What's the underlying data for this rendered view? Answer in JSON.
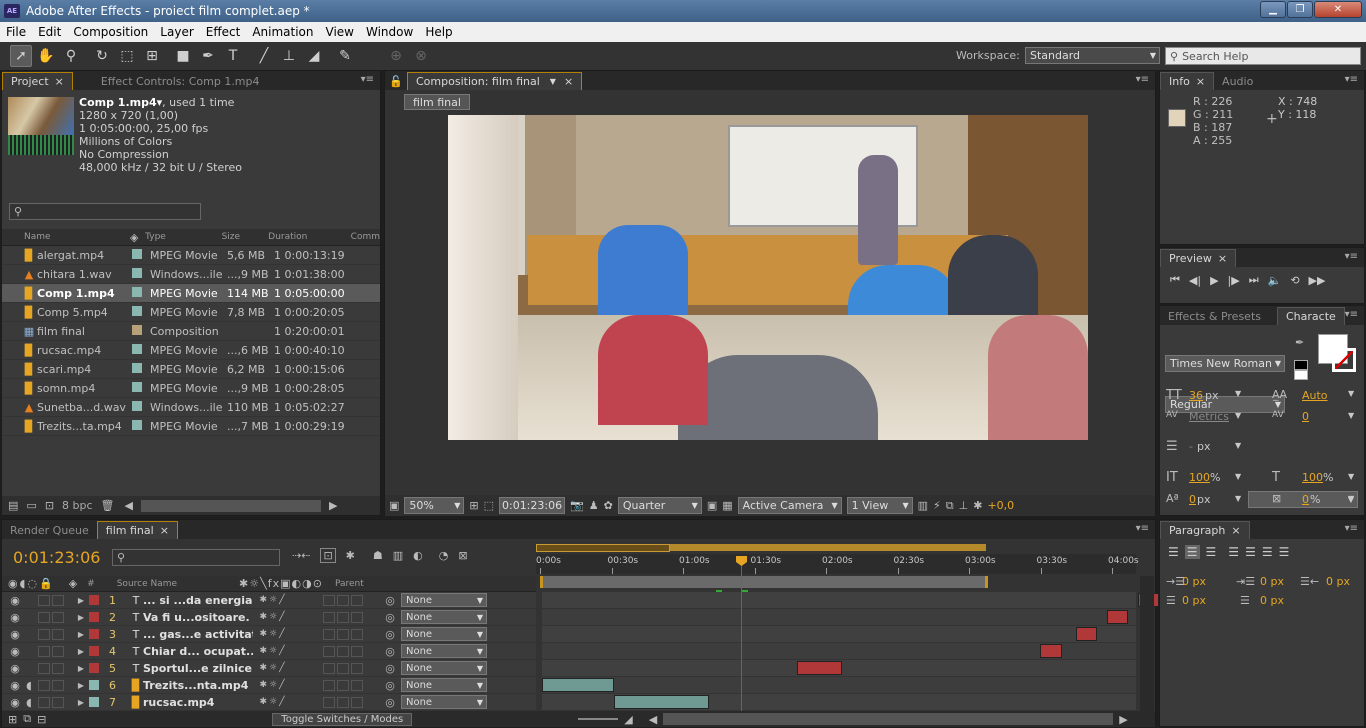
{
  "app": {
    "title": "Adobe After Effects - proiect film complet.aep *",
    "logo": "AE"
  },
  "menu": [
    "File",
    "Edit",
    "Composition",
    "Layer",
    "Effect",
    "Animation",
    "View",
    "Window",
    "Help"
  ],
  "toolbar": {
    "tools": [
      "selection-icon",
      "hand-icon",
      "zoom-icon",
      "rotation-icon",
      "camera-orbit-icon",
      "pan-behind-icon",
      "rectangle-mask-icon",
      "pen-icon",
      "type-icon",
      "brush-icon",
      "clone-stamp-icon",
      "eraser-icon",
      "puppet-pin-icon"
    ],
    "workspace_label": "Workspace:",
    "workspace_value": "Standard",
    "search_placeholder": "Search Help"
  },
  "project": {
    "tab_project": "Project",
    "tab_effect_controls": "Effect Controls: Comp 1.mp4",
    "footage_name": "Comp 1.mp4▾",
    "footage_used": ", used 1 time",
    "details": [
      "1280 x 720 (1,00)",
      "1 0:05:00:00, 25,00 fps",
      "Millions of Colors",
      "No Compression",
      "48,000 kHz / 32 bit U / Stereo"
    ],
    "columns": {
      "name": "Name",
      "type": "Type",
      "size": "Size",
      "duration": "Duration",
      "comment": "Comm"
    },
    "items": [
      {
        "name": "alergat.mp4",
        "type": "MPEG Movie",
        "size": "5,6 MB",
        "duration": "1 0:00:13:19",
        "icon": "movie-file-icon",
        "label": "#8ab8b0"
      },
      {
        "name": "chitara 1.wav",
        "type": "Windows...ile",
        "size": "...,9 MB",
        "duration": "1 0:01:38:00",
        "icon": "audio-file-icon",
        "label": "#8ab8b0"
      },
      {
        "name": "Comp 1.mp4",
        "type": "MPEG Movie",
        "size": "114 MB",
        "duration": "1 0:05:00:00",
        "icon": "movie-file-icon",
        "label": "#8ab8b0",
        "selected": true
      },
      {
        "name": "Comp 5.mp4",
        "type": "MPEG Movie",
        "size": "7,8 MB",
        "duration": "1 0:00:20:05",
        "icon": "movie-file-icon",
        "label": "#8ab8b0"
      },
      {
        "name": "film final",
        "type": "Composition",
        "size": "",
        "duration": "1 0:20:00:01",
        "icon": "composition-icon",
        "label": "#b8a078"
      },
      {
        "name": "rucsac.mp4",
        "type": "MPEG Movie",
        "size": "...,6 MB",
        "duration": "1 0:00:40:10",
        "icon": "movie-file-icon",
        "label": "#8ab8b0"
      },
      {
        "name": "scari.mp4",
        "type": "MPEG Movie",
        "size": "6,2 MB",
        "duration": "1 0:00:15:06",
        "icon": "movie-file-icon",
        "label": "#8ab8b0"
      },
      {
        "name": "somn.mp4",
        "type": "MPEG Movie",
        "size": "...,9 MB",
        "duration": "1 0:00:28:05",
        "icon": "movie-file-icon",
        "label": "#8ab8b0"
      },
      {
        "name": "Sunetba...d.wav",
        "type": "Windows...ile",
        "size": "110 MB",
        "duration": "1 0:05:02:27",
        "icon": "audio-file-icon",
        "label": "#8ab8b0"
      },
      {
        "name": "Trezits...ta.mp4",
        "type": "MPEG Movie",
        "size": "...,7 MB",
        "duration": "1 0:00:29:19",
        "icon": "movie-file-icon",
        "label": "#8ab8b0"
      }
    ],
    "bpc": "8 bpc"
  },
  "composition": {
    "tab": "Composition: film final",
    "crumb": "film final",
    "zoom": "50%",
    "timecode": "0:01:23:06",
    "resolution": "Quarter",
    "camera": "Active Camera",
    "views": "1 View",
    "exposure": "+0,0"
  },
  "info": {
    "tab_info": "Info",
    "tab_audio": "Audio",
    "r": "R : 226",
    "g": "G : 211",
    "b": "B : 187",
    "a": "A : 255",
    "x": "X : 748",
    "y": "Y : 118",
    "sample_color": "#e2d3bb"
  },
  "preview": {
    "tab": "Preview"
  },
  "character": {
    "tab_effects": "Effects & Presets",
    "tab_character": "Characte",
    "font": "Times New Roman",
    "style": "Regular",
    "size": "36",
    "size_unit": "px",
    "leading": "Auto",
    "kerning": "Metrics",
    "tracking": "0",
    "stroke": "-",
    "stroke_unit": "px",
    "vscale": "100",
    "hscale": "100",
    "percent": "%",
    "baseline": "0",
    "baseline_unit": "px",
    "tsume": "0",
    "tsume_unit": "%"
  },
  "paragraph": {
    "tab": "Paragraph",
    "indent_left": "0 px",
    "indent_first": "0 px",
    "indent_right": "0 px",
    "space_before": "0 px",
    "space_after": "0 px"
  },
  "timeline": {
    "tab_render": "Render Queue",
    "tab_comp": "film final",
    "timecode": "0:01:23:06",
    "col_source": "Source Name",
    "col_parent": "Parent",
    "ruler": [
      "0:00s",
      "00:30s",
      "01:00s",
      "01:30s",
      "02:00s",
      "02:30s",
      "03:00s",
      "03:30s",
      "04:00s"
    ],
    "toggle": "Toggle Switches / Modes",
    "layers": [
      {
        "num": "1",
        "name": "... si ...da energia.",
        "kind": "text",
        "label": "#b03838",
        "parent": "None",
        "bar": {
          "start": 250,
          "end": 259,
          "color": "#b03838"
        }
      },
      {
        "num": "2",
        "name": "Va fi u...ositoare.",
        "kind": "text",
        "label": "#b03838",
        "parent": "None",
        "bar": {
          "start": 237,
          "end": 246,
          "color": "#b03838"
        }
      },
      {
        "num": "3",
        "name": "... gas...e activitati",
        "kind": "text",
        "label": "#b03838",
        "parent": "None",
        "bar": {
          "start": 224,
          "end": 233,
          "color": "#b03838"
        }
      },
      {
        "num": "4",
        "name": "Chiar d... ocupat...",
        "kind": "text",
        "label": "#b03838",
        "parent": "None",
        "bar": {
          "start": 209,
          "end": 218,
          "color": "#b03838"
        }
      },
      {
        "num": "5",
        "name": "Sportul...e zilnice.",
        "kind": "text",
        "label": "#b03838",
        "parent": "None",
        "bar": {
          "start": 107,
          "end": 126,
          "color": "#b03838"
        }
      },
      {
        "num": "6",
        "name": "Trezits...nta.mp4",
        "kind": "footage",
        "label": "#8ab8b0",
        "parent": "None",
        "bar": {
          "start": 0,
          "end": 30,
          "color": "#6f9a94"
        }
      },
      {
        "num": "7",
        "name": "rucsac.mp4",
        "kind": "footage",
        "label": "#8ab8b0",
        "parent": "None",
        "bar": {
          "start": 30,
          "end": 70,
          "color": "#6f9a94"
        }
      }
    ]
  }
}
